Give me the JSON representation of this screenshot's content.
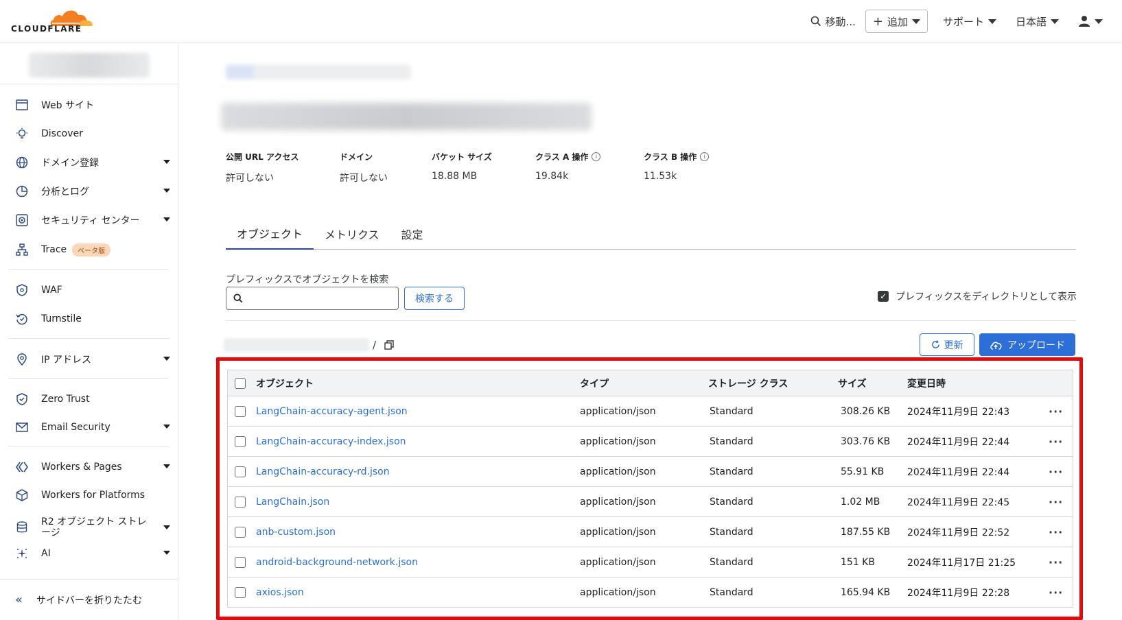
{
  "header": {
    "logo_text": "CLOUDFLARE",
    "search_label": "移動...",
    "add_label": "追加",
    "support_label": "サポート",
    "language_label": "日本語",
    "brand_color": "#f38020"
  },
  "sidebar": {
    "items": [
      {
        "label": "Web サイト",
        "icon": "browser-window-icon"
      },
      {
        "label": "Discover",
        "icon": "lightbulb-icon"
      },
      {
        "label": "ドメイン登録",
        "icon": "globe-icon"
      },
      {
        "label": "分析とログ",
        "icon": "pie-chart-icon"
      },
      {
        "label": "セキュリティ センター",
        "icon": "security-center-icon"
      },
      {
        "label": "Trace",
        "icon": "trace-icon",
        "badge": "ベータ版"
      },
      {
        "label": "WAF",
        "icon": "shield-icon"
      },
      {
        "label": "Turnstile",
        "icon": "turnstile-icon"
      },
      {
        "label": "IP アドレス",
        "icon": "location-pin-icon"
      },
      {
        "label": "Zero Trust",
        "icon": "zero-trust-icon"
      },
      {
        "label": "Email Security",
        "icon": "envelope-icon"
      },
      {
        "label": "Workers & Pages",
        "icon": "workers-icon"
      },
      {
        "label": "Workers for Platforms",
        "icon": "cube-icon"
      },
      {
        "label": "R2 オブジェクト ストレージ",
        "icon": "database-icon"
      },
      {
        "label": "AI",
        "icon": "sparkle-icon"
      }
    ],
    "collapse_label": "サイドバーを折りたたむ"
  },
  "stats": [
    {
      "label": "公開 URL アクセス",
      "value": "許可しない"
    },
    {
      "label": "ドメイン",
      "value": "許可しない"
    },
    {
      "label": "バケット サイズ",
      "value": "18.88 MB"
    },
    {
      "label": "クラス A 操作",
      "value": "19.84k"
    },
    {
      "label": "クラス B 操作",
      "value": "11.53k"
    }
  ],
  "tabs": [
    "オブジェクト",
    "メトリクス",
    "設定"
  ],
  "search": {
    "label": "プレフィックスでオブジェクトを検索",
    "value": "",
    "button": "検索する",
    "dir_toggle_label": "プレフィックスをディレクトリとして表示"
  },
  "path": {
    "separator": "/"
  },
  "actions": {
    "refresh": "更新",
    "upload": "アップロード"
  },
  "table": {
    "columns": [
      "オブジェクト",
      "タイプ",
      "ストレージ クラス",
      "サイズ",
      "変更日時"
    ],
    "rows": [
      {
        "name": "LangChain-accuracy-agent.json",
        "type": "application/json",
        "storage": "Standard",
        "size": "308.26 KB",
        "modified": "2024年11月9日 22:43"
      },
      {
        "name": "LangChain-accuracy-index.json",
        "type": "application/json",
        "storage": "Standard",
        "size": "303.76 KB",
        "modified": "2024年11月9日 22:44"
      },
      {
        "name": "LangChain-accuracy-rd.json",
        "type": "application/json",
        "storage": "Standard",
        "size": "55.91 KB",
        "modified": "2024年11月9日 22:44"
      },
      {
        "name": "LangChain.json",
        "type": "application/json",
        "storage": "Standard",
        "size": "1.02 MB",
        "modified": "2024年11月9日 22:45"
      },
      {
        "name": "anb-custom.json",
        "type": "application/json",
        "storage": "Standard",
        "size": "187.55 KB",
        "modified": "2024年11月9日 22:52"
      },
      {
        "name": "android-background-network.json",
        "type": "application/json",
        "storage": "Standard",
        "size": "151 KB",
        "modified": "2024年11月17日 21:25"
      },
      {
        "name": "axios.json",
        "type": "application/json",
        "storage": "Standard",
        "size": "165.94 KB",
        "modified": "2024年11月9日 22:28"
      }
    ],
    "row_menu": "···"
  }
}
